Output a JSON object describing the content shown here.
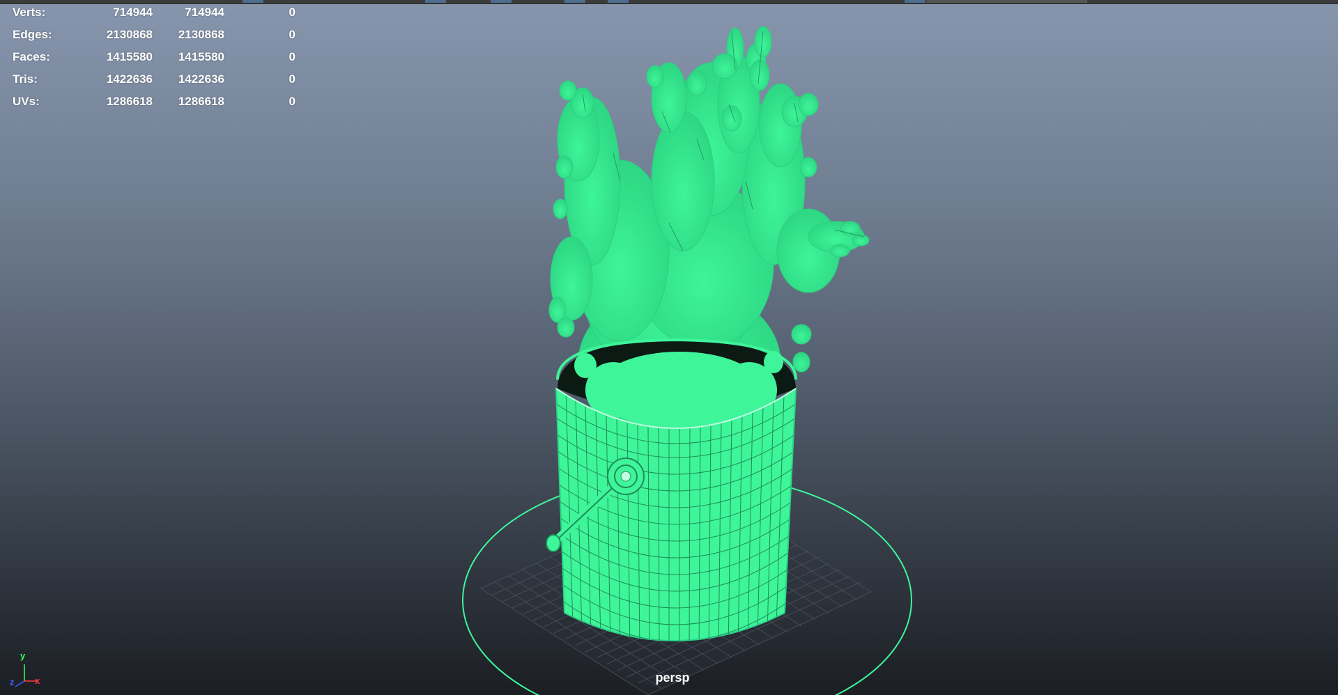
{
  "viewport": {
    "camera_name": "persp",
    "background_top_color": "#8796ad",
    "background_bottom_color": "#1b1e23",
    "wireframe_color": "#3ef59a"
  },
  "hud": {
    "rows": [
      {
        "label": "Verts:",
        "c1": "714944",
        "c2": "714944",
        "c3": "0"
      },
      {
        "label": "Edges:",
        "c1": "2130868",
        "c2": "2130868",
        "c3": "0"
      },
      {
        "label": "Faces:",
        "c1": "1415580",
        "c2": "1415580",
        "c3": "0"
      },
      {
        "label": "Tris:",
        "c1": "1422636",
        "c2": "1422636",
        "c3": "0"
      },
      {
        "label": "UVs:",
        "c1": "1286618",
        "c2": "1286618",
        "c3": "0"
      }
    ]
  },
  "axis": {
    "y": "y",
    "x": "x",
    "z": "z",
    "x_color": "#ff3b3b",
    "y_color": "#3bff5a",
    "z_color": "#4060ff"
  }
}
